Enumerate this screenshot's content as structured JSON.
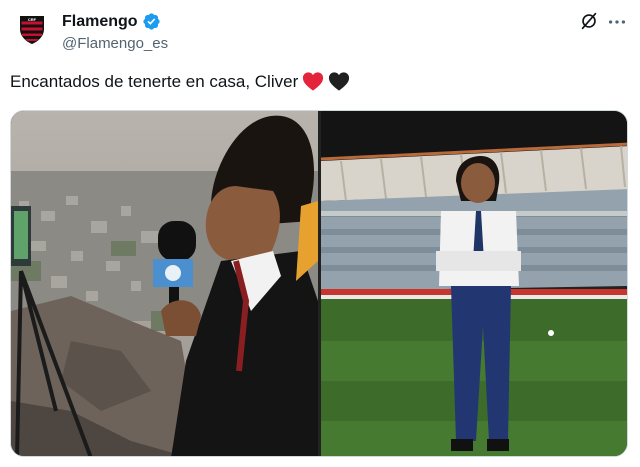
{
  "account": {
    "display_name": "Flamengo",
    "handle": "@Flamengo_es",
    "avatar_icon": "flamengo-crest-icon",
    "verified_icon": "verified-badge-icon",
    "verified_color": "#1d9bf0"
  },
  "header_actions": {
    "grok_icon": "grok-icon",
    "more_icon": "more-options-icon"
  },
  "tweet": {
    "text": "Encantados de tenerte en casa, Cliver",
    "emojis": [
      "red-heart-icon",
      "black-heart-icon"
    ]
  },
  "media": {
    "photos": [
      {
        "name": "photo-reporter-hillside",
        "description_icon": "image"
      },
      {
        "name": "photo-stadium-pitch",
        "description_icon": "image"
      }
    ]
  },
  "colors": {
    "text_primary": "#0f1419",
    "text_secondary": "#536471",
    "border": "#cfd9de",
    "flamengo_red": "#c8102e",
    "heart_red": "#e3243b",
    "heart_black": "#202020"
  }
}
